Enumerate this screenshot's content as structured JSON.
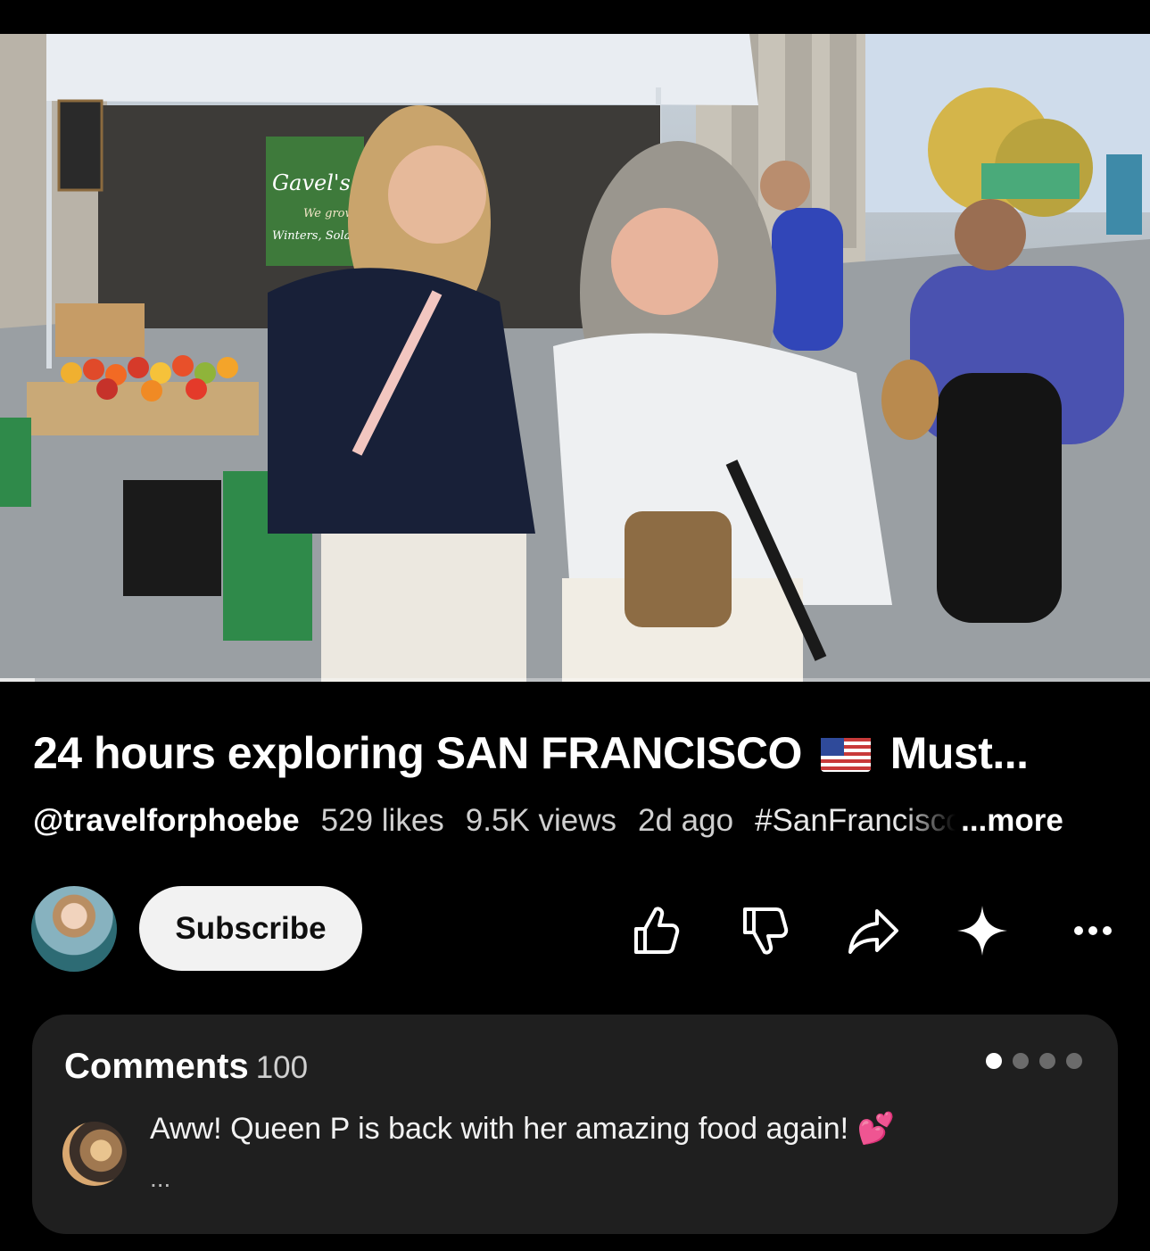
{
  "video": {
    "thumbnail_description_icon": "video-frame",
    "sign_text_main": "Gavel's",
    "sign_text_sub": "We grow",
    "sign_text_loc": "Winters, Solano",
    "progress_fraction": 0.03
  },
  "title": {
    "text_before_flag": "24 hours exploring SAN FRANCISCO",
    "flag_icon": "us-flag-icon",
    "text_after_flag": "Must..."
  },
  "meta": {
    "handle": "@travelforphoebe",
    "likes": "529 likes",
    "views": "9.5K views",
    "age": "2d ago",
    "hashtag": "#SanFrancisco",
    "more": "...more"
  },
  "channel": {
    "avatar_icon": "channel-avatar",
    "subscribe_label": "Subscribe"
  },
  "actions": [
    {
      "name": "like",
      "icon": "thumbs-up-icon"
    },
    {
      "name": "dislike",
      "icon": "thumbs-down-icon"
    },
    {
      "name": "share",
      "icon": "share-arrow-icon"
    },
    {
      "name": "remix",
      "icon": "sparkle-icon"
    },
    {
      "name": "more",
      "icon": "more-horizontal-icon"
    }
  ],
  "comments": {
    "heading": "Comments",
    "count": "100",
    "pager": {
      "total": 4,
      "active": 1
    },
    "top_comment": {
      "text": "Aww! Queen P is back with her amazing food again! 💕",
      "ellipsis": "..."
    }
  },
  "colors": {
    "background": "#000000",
    "panel": "#1f1f1f",
    "subscribe_bg": "#f2f2f2",
    "muted_text": "#cfcfcf"
  }
}
